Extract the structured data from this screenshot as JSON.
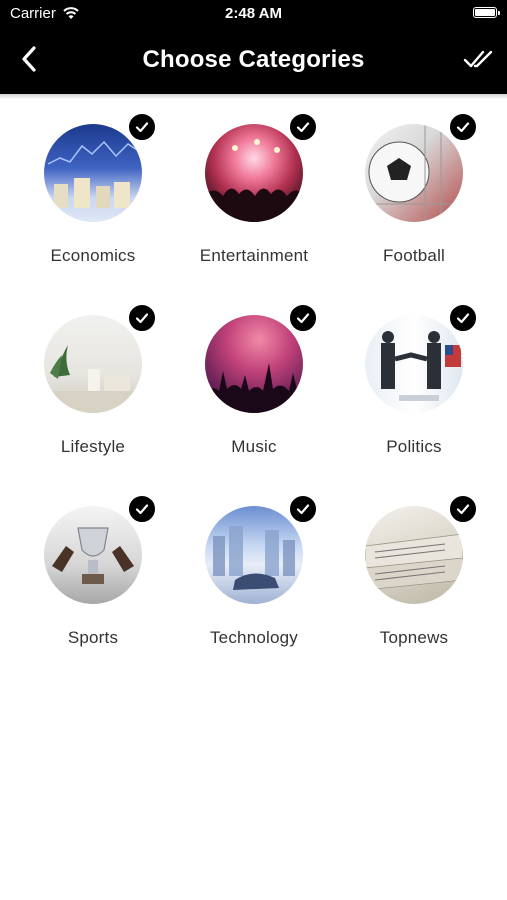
{
  "status_bar": {
    "carrier": "Carrier",
    "time": "2:48 AM"
  },
  "header": {
    "title": "Choose Categories",
    "back_icon": "back-chevron-icon",
    "done_icon": "double-check-icon"
  },
  "categories": [
    {
      "label": "Economics",
      "selected": true
    },
    {
      "label": "Entertainment",
      "selected": true
    },
    {
      "label": "Football",
      "selected": true
    },
    {
      "label": "Lifestyle",
      "selected": true
    },
    {
      "label": "Music",
      "selected": true
    },
    {
      "label": "Politics",
      "selected": true
    },
    {
      "label": "Sports",
      "selected": true
    },
    {
      "label": "Technology",
      "selected": true
    },
    {
      "label": "Topnews",
      "selected": true
    }
  ],
  "colors": {
    "header_bg": "#000000",
    "check_bg": "#000000",
    "label_text": "#333333"
  }
}
